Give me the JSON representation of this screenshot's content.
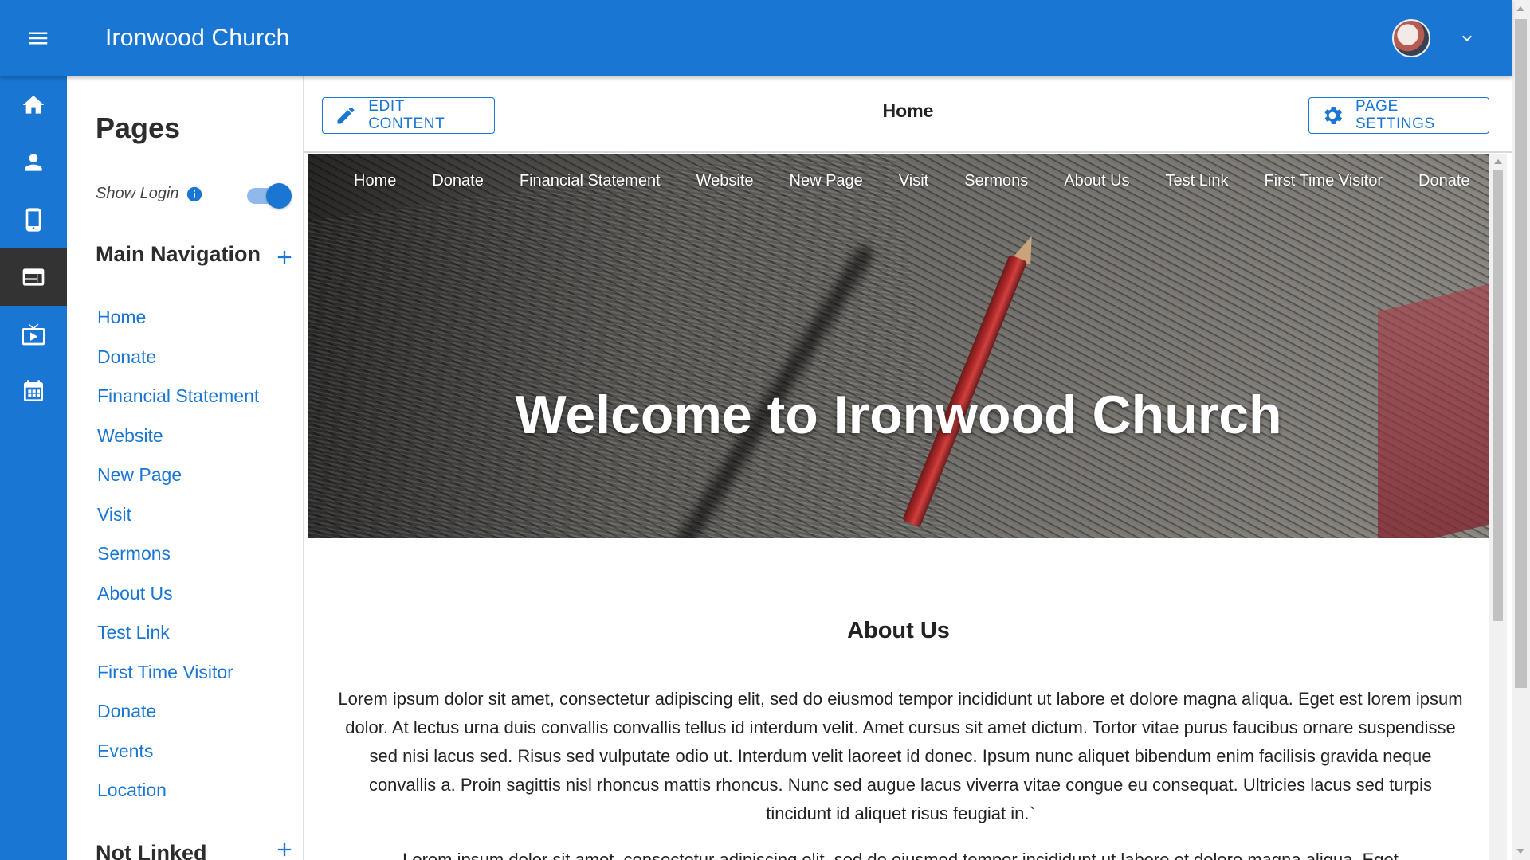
{
  "app": {
    "title": "Ironwood Church"
  },
  "colors": {
    "primary": "#1976d2",
    "rail_active": "#333333",
    "link": "#1976d2"
  },
  "rail": {
    "items": [
      {
        "icon": "home-icon",
        "active": false
      },
      {
        "icon": "person-icon",
        "active": false
      },
      {
        "icon": "mobile-icon",
        "active": false
      },
      {
        "icon": "web-icon",
        "active": true
      },
      {
        "icon": "live-tv-icon",
        "active": false
      },
      {
        "icon": "calendar-icon",
        "active": false
      }
    ]
  },
  "pages_panel": {
    "title": "Pages",
    "show_login_label": "Show Login",
    "show_login_on": true,
    "main_nav_heading": "Main Navigation",
    "main_nav_items": [
      "Home",
      "Donate",
      "Financial Statement",
      "Website",
      "New Page",
      "Visit",
      "Sermons",
      "About Us",
      "Test Link",
      "First Time Visitor",
      "Donate",
      "Events",
      "Location"
    ],
    "not_linked_heading": "Not Linked"
  },
  "toolbar": {
    "edit_label": "EDIT CONTENT",
    "page_name": "Home",
    "settings_label": "PAGE SETTINGS"
  },
  "hero": {
    "nav_items": [
      "Home",
      "Donate",
      "Financial Statement",
      "Website",
      "New Page",
      "Visit",
      "Sermons",
      "About Us",
      "Test Link",
      "First Time Visitor",
      "Donate"
    ],
    "title": "Welcome to Ironwood Church"
  },
  "about": {
    "title": "About Us",
    "body": "Lorem ipsum dolor sit amet, consectetur adipiscing elit, sed do eiusmod tempor incididunt ut labore et dolore magna aliqua. Eget est lorem ipsum dolor. At lectus urna duis convallis convallis tellus id interdum velit. Amet cursus sit amet dictum. Tortor vitae purus faucibus ornare suspendisse sed nisi lacus sed. Risus sed vulputate odio ut. Interdum velit laoreet id donec. Ipsum nunc aliquet bibendum enim facilisis gravida neque convallis a. Proin sagittis nisl rhoncus mattis rhoncus. Nunc sed augue lacus viverra vitae congue eu consequat. Ultricies lacus sed turpis tincidunt id aliquet risus feugiat in.`",
    "body2": "Lorem ipsum dolor sit amet, consectetur adipiscing elit, sed do eiusmod tempor incididunt ut labore et dolore magna aliqua. Eget"
  }
}
